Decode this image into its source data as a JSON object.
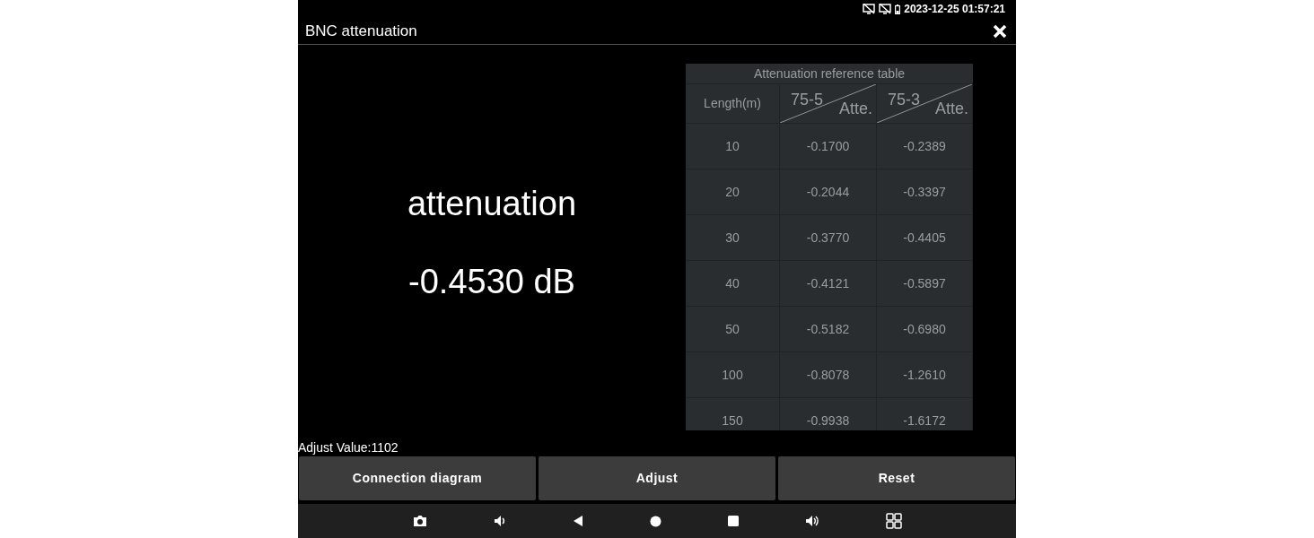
{
  "status_bar": {
    "time": "2023-12-25 01:57:21"
  },
  "window": {
    "title": "BNC attenuation"
  },
  "reading": {
    "label": "attenuation",
    "value": "-0.4530 dB"
  },
  "reference_table": {
    "title": "Attenuation reference table",
    "columns": [
      {
        "kind": "plain",
        "label": "Length(m)"
      },
      {
        "kind": "split",
        "top": "75-5",
        "bottom": "Atte."
      },
      {
        "kind": "split",
        "top": "75-3",
        "bottom": "Atte."
      }
    ],
    "rows": [
      [
        "10",
        "-0.1700",
        "-0.2389"
      ],
      [
        "20",
        "-0.2044",
        "-0.3397"
      ],
      [
        "30",
        "-0.3770",
        "-0.4405"
      ],
      [
        "40",
        "-0.4121",
        "-0.5897"
      ],
      [
        "50",
        "-0.5182",
        "-0.6980"
      ],
      [
        "100",
        "-0.8078",
        "-1.2610"
      ],
      [
        "150",
        "-0.9938",
        "-1.6172"
      ]
    ]
  },
  "adjust_value": "Adjust Value:1102",
  "buttons": [
    "Connection diagram",
    "Adjust",
    "Reset"
  ]
}
